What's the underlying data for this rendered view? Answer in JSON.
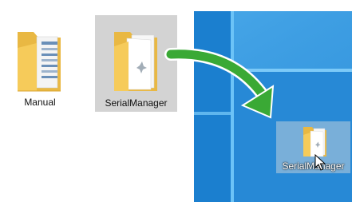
{
  "explorer": {
    "items": [
      {
        "label": "Manual",
        "icon": "folder-icon"
      },
      {
        "label": "SerialManager",
        "icon": "folder-icon"
      }
    ]
  },
  "desktop": {
    "dropped_item": {
      "label": "SerialManager",
      "icon": "folder-icon"
    }
  },
  "colors": {
    "desktop_accent": "#1478c6",
    "arrow_green": "#3aa935",
    "selection_gray": "#d3d3d3"
  }
}
